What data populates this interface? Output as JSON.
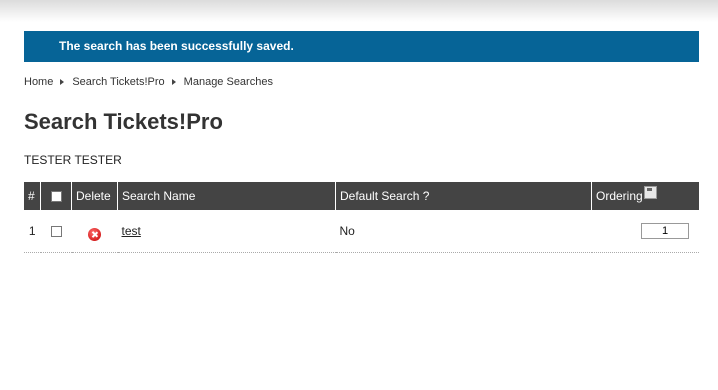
{
  "notice": {
    "message": "The search has been successfully saved."
  },
  "breadcrumb": {
    "items": [
      "Home",
      "Search Tickets!Pro",
      "Manage Searches"
    ]
  },
  "page": {
    "title": "Search Tickets!Pro",
    "user": "TESTER TESTER"
  },
  "table": {
    "headers": {
      "num": "#",
      "delete": "Delete",
      "name": "Search Name",
      "default": "Default Search ?",
      "ordering": "Ordering"
    },
    "rows": [
      {
        "num": "1",
        "name": "test",
        "default": "No",
        "ordering": "1"
      }
    ]
  },
  "colors": {
    "notice_bg": "#066497",
    "header_bg": "#444444"
  },
  "icons": {
    "delete": "delete-icon",
    "save_order": "save-icon",
    "breadcrumb_sep": "triangle-right-icon"
  }
}
